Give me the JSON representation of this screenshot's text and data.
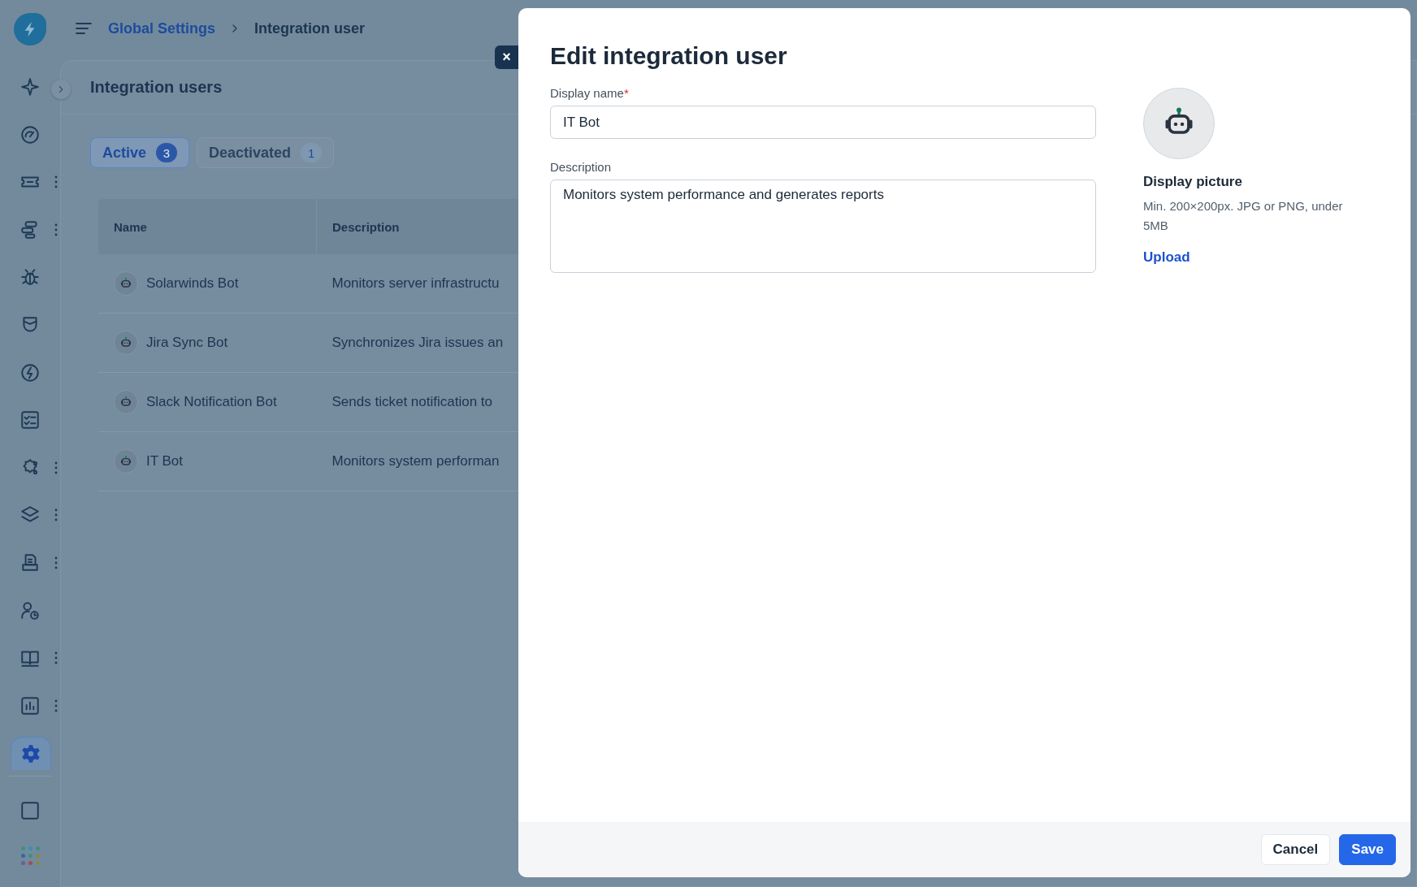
{
  "breadcrumb": [
    {
      "label": "Global Settings",
      "link": true
    },
    {
      "label": "Integration user",
      "link": false
    }
  ],
  "sidebar": {
    "items": [
      {
        "selected": false,
        "menu": false
      },
      {
        "selected": false,
        "menu": false
      },
      {
        "selected": false,
        "menu": true
      },
      {
        "selected": false,
        "menu": true
      },
      {
        "selected": false,
        "menu": false
      },
      {
        "selected": false,
        "menu": false
      },
      {
        "selected": false,
        "menu": false
      },
      {
        "selected": false,
        "menu": false
      },
      {
        "selected": false,
        "menu": true
      },
      {
        "selected": false,
        "menu": true
      },
      {
        "selected": false,
        "menu": true
      },
      {
        "selected": false,
        "menu": false
      },
      {
        "selected": false,
        "menu": true
      },
      {
        "selected": false,
        "menu": true
      },
      {
        "selected": true,
        "menu": false
      }
    ]
  },
  "page": {
    "title": "Integration users",
    "tabs": [
      {
        "label": "Active",
        "count": "3",
        "selected": true
      },
      {
        "label": "Deactivated",
        "count": "1",
        "selected": false
      }
    ],
    "table": {
      "columns": [
        "Name",
        "Description"
      ],
      "rows": [
        {
          "name": "Solarwinds Bot",
          "description": "Monitors server infrastructu"
        },
        {
          "name": "Jira Sync Bot",
          "description": "Synchronizes Jira issues an"
        },
        {
          "name": "Slack Notification Bot",
          "description": "Sends ticket notification to"
        },
        {
          "name": "IT Bot",
          "description": "Monitors system performan"
        }
      ]
    }
  },
  "dialog": {
    "close": "×",
    "title": "Edit integration user",
    "fields": [
      {
        "kind": "input",
        "label": "Display name",
        "required_mark": "*",
        "value": "IT Bot"
      },
      {
        "kind": "textarea",
        "label": "Description",
        "value": "Monitors system performance and generates reports"
      }
    ],
    "picture": {
      "title": "Display picture",
      "hint": "Min. 200×200px. JPG or PNG, under 5MB",
      "action": "Upload"
    },
    "buttons": [
      {
        "kind": "secondary",
        "label": "Cancel"
      },
      {
        "kind": "primary",
        "label": "Save"
      }
    ]
  }
}
